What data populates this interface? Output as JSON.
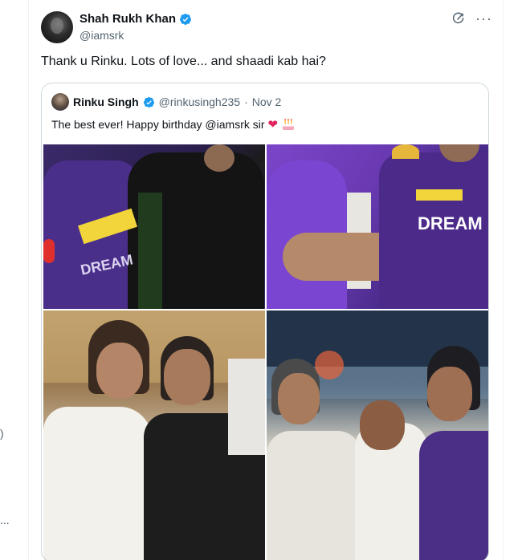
{
  "tweet": {
    "display_name": "Shah Rukh Khan",
    "handle": "@iamsrk",
    "text": "Thank u Rinku. Lots of love... and shaadi kab hai?",
    "icons": {
      "verified": "verified-badge-icon",
      "grok": "grok-icon",
      "more": "more-icon"
    },
    "colors": {
      "verified": "#1d9bf0",
      "secondary_text": "#536471",
      "border": "#cfd9de"
    }
  },
  "quote": {
    "display_name": "Rinku Singh",
    "handle": "@rinkusingh235",
    "separator": "·",
    "date": "Nov 2",
    "text": "The best ever! Happy birthday @iamsrk sir",
    "emojis": [
      "heart-emoji",
      "birthday-cake-emoji"
    ],
    "photos": [
      {
        "name": "photo-kkr-celebration"
      },
      {
        "name": "photo-kkr-handshake"
      },
      {
        "name": "photo-selfie-event"
      },
      {
        "name": "photo-stadium-greeting"
      }
    ],
    "jersey_text": [
      "DREAM",
      "DREAM"
    ]
  },
  "gutter": {
    "left_marks": [
      ")",
      "..."
    ]
  }
}
